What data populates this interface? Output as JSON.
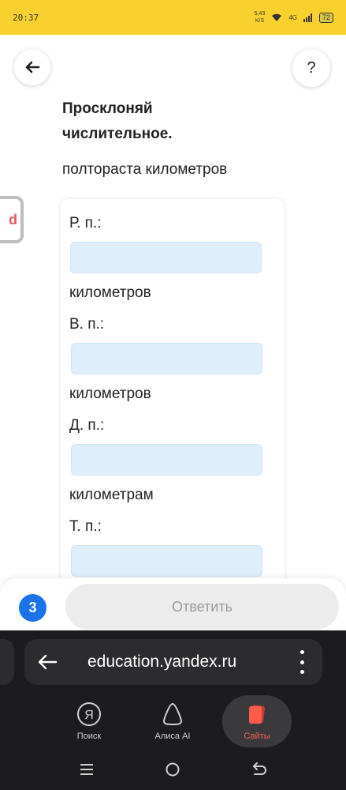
{
  "status_bar": {
    "time": "20:37",
    "speed_value": "5,43",
    "speed_unit": "K/S",
    "network": "4G",
    "battery": "72"
  },
  "task": {
    "title": "Просклоняй числительное.",
    "phrase": "полтораста километров",
    "cases": [
      {
        "label": "Р. п.:",
        "value": "",
        "word": "километров"
      },
      {
        "label": "В. п.:",
        "value": "",
        "word": "километров"
      },
      {
        "label": "Д. п.:",
        "value": "",
        "word": "километрам"
      },
      {
        "label": "Т. п.:",
        "value": ""
      }
    ]
  },
  "nav": {
    "help_label": "?"
  },
  "answer_bar": {
    "counter": "3",
    "submit_label": "Ответить"
  },
  "browser": {
    "url": "education.yandex.ru",
    "tabs": [
      {
        "label": "Поиск",
        "icon": "yandex-logo-icon"
      },
      {
        "label": "Алиса AI",
        "icon": "alice-icon"
      },
      {
        "label": "Сайты",
        "icon": "sites-icon"
      }
    ]
  },
  "colors": {
    "status_bar": "#f9d12e",
    "accent_blue": "#1a73e8",
    "input_fill": "#dfeefd",
    "active_tab": "#ff5b4a"
  }
}
